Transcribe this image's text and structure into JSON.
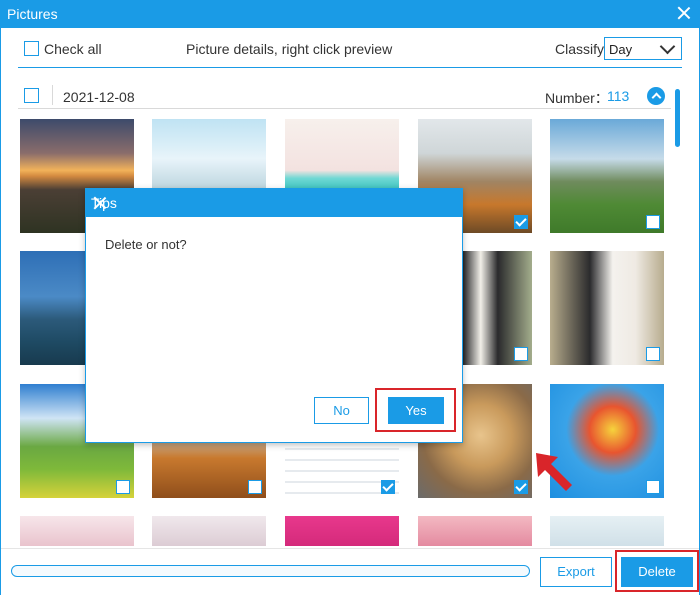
{
  "window": {
    "title": "Pictures"
  },
  "toolbar": {
    "check_all": "Check all",
    "hint": "Picture details, right click preview",
    "classify_label": "Classify:",
    "classify_value": "Day"
  },
  "group": {
    "date": "2021-12-08",
    "number_label": "Number：",
    "number_value": "113"
  },
  "photos": [
    {
      "name": "sunset-mountains",
      "checked": false
    },
    {
      "name": "snowy-trees",
      "checked": false
    },
    {
      "name": "sunglasses",
      "checked": false
    },
    {
      "name": "autumn-trees",
      "checked": true
    },
    {
      "name": "green-valley",
      "checked": false
    },
    {
      "name": "lake-mountains",
      "checked": false
    },
    {
      "name": "wedding-couple",
      "checked": false
    },
    {
      "name": "wedding-couple-2",
      "checked": false
    },
    {
      "name": "meadow-cabin",
      "checked": false
    },
    {
      "name": "autumn-forest",
      "checked": false
    },
    {
      "name": "document-screenshot",
      "checked": true
    },
    {
      "name": "puppy",
      "checked": true
    },
    {
      "name": "colorful-swirl",
      "checked": false
    }
  ],
  "footer": {
    "export_label": "Export",
    "delete_label": "Delete"
  },
  "dialog": {
    "title": "Tips",
    "message": "Delete or not?",
    "no_label": "No",
    "yes_label": "Yes"
  },
  "colors": {
    "accent": "#1a9be6",
    "highlight": "#d9252a"
  }
}
